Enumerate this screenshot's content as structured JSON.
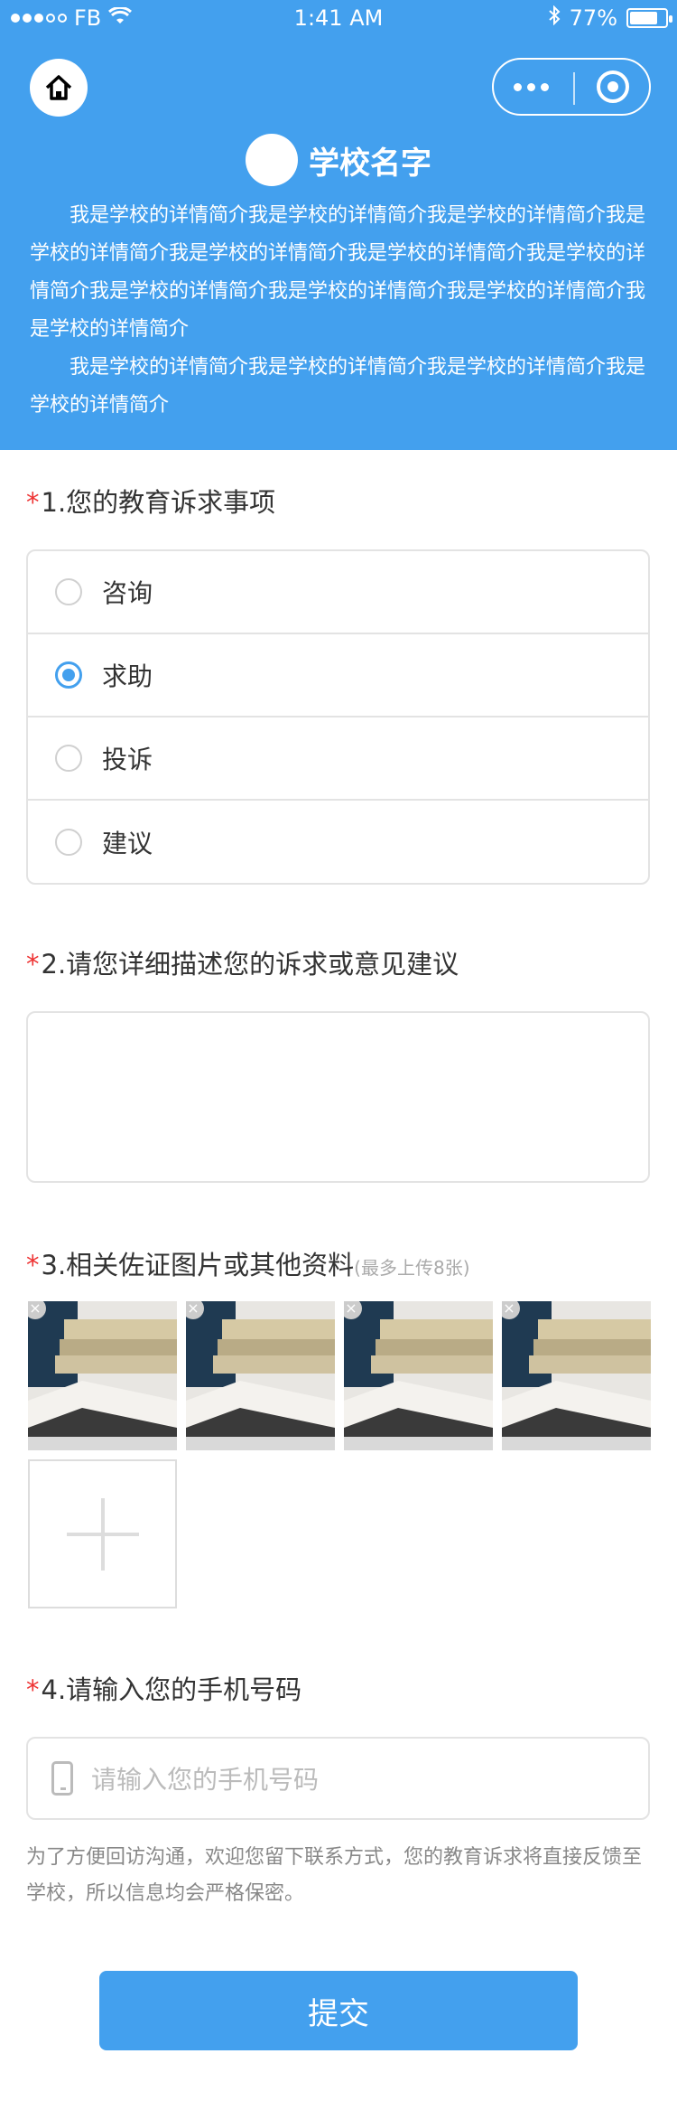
{
  "status_bar": {
    "carrier": "FB",
    "time": "1:41 AM",
    "battery": "77%"
  },
  "header": {
    "school_name": "学校名字",
    "intro_paragraphs": [
      "我是学校的详情简介我是学校的详情简介我是学校的详情简介我是学校的详情简介我是学校的详情简介我是学校的详情简介我是学校的详情简介我是学校的详情简介我是学校的详情简介我是学校的详情简介我是学校的详情简介",
      "我是学校的详情简介我是学校的详情简介我是学校的详情简介我是学校的详情简介"
    ]
  },
  "questions": {
    "q1": {
      "star": "*",
      "title": "1.您的教育诉求事项"
    },
    "q2": {
      "star": "*",
      "title": "2.请您详细描述您的诉求或意见建议"
    },
    "q3": {
      "star": "*",
      "title": "3.相关佐证图片或其他资料",
      "hint": "(最多上传8张)"
    },
    "q4": {
      "star": "*",
      "title": "4.请输入您的手机号码"
    }
  },
  "options": [
    {
      "label": "咨询",
      "checked": false
    },
    {
      "label": "求助",
      "checked": true
    },
    {
      "label": "投诉",
      "checked": false
    },
    {
      "label": "建议",
      "checked": false
    }
  ],
  "textarea": {
    "value": ""
  },
  "images": {
    "delete_label": "×"
  },
  "phone": {
    "placeholder": "请输入您的手机号码"
  },
  "note": "为了方便回访沟通，欢迎您留下联系方式，您的教育诉求将直接反馈至学校，所以信息均会严格保密。",
  "submit_label": "提交",
  "colors": {
    "primary": "#43a0ee",
    "required": "#e33333"
  }
}
